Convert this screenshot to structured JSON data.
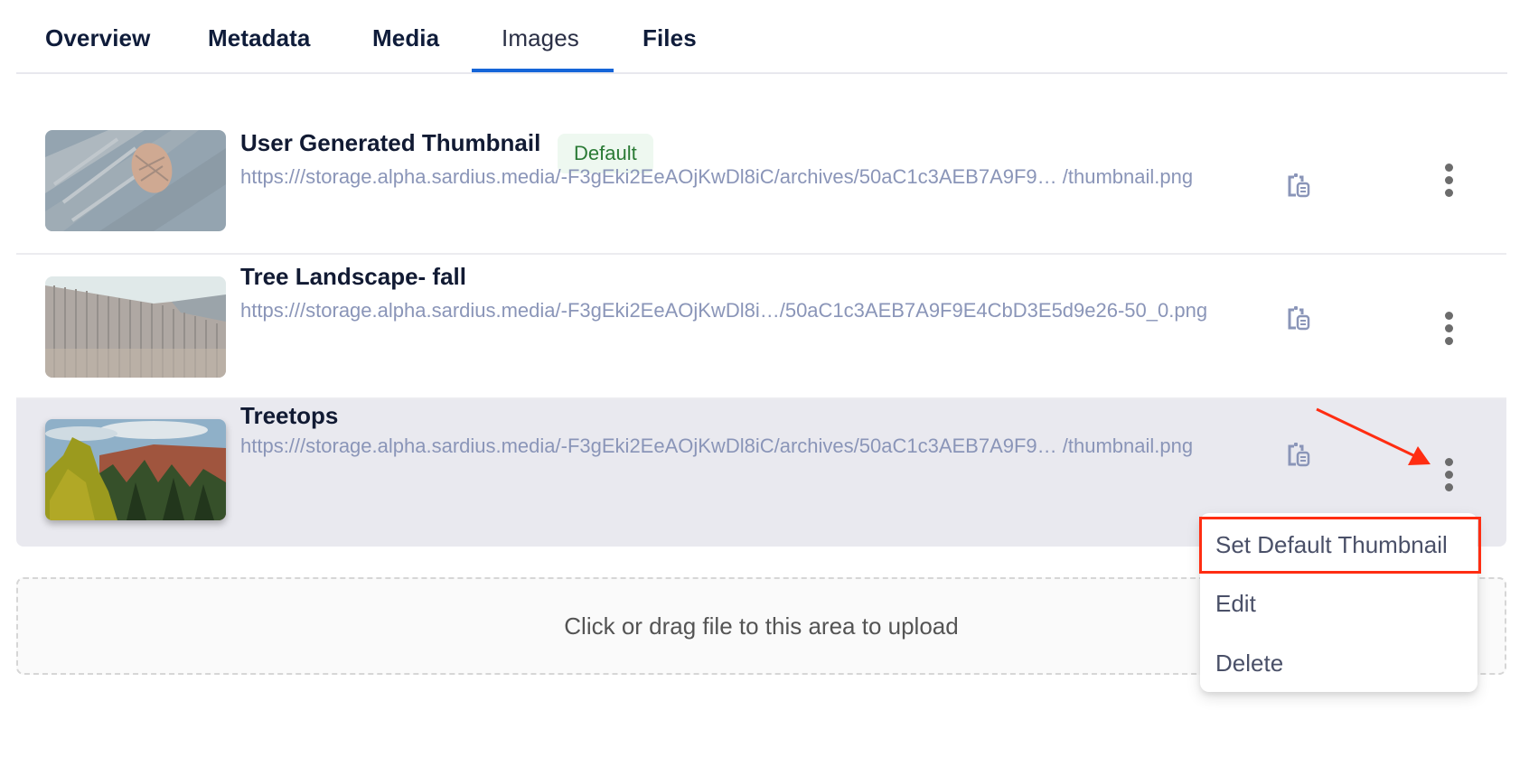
{
  "tabs": [
    {
      "label": "Overview",
      "active": false
    },
    {
      "label": "Metadata",
      "active": false
    },
    {
      "label": "Media",
      "active": false
    },
    {
      "label": "Images",
      "active": true
    },
    {
      "label": "Files",
      "active": false
    }
  ],
  "images": [
    {
      "title": "User Generated Thumbnail",
      "badge": "Default",
      "url": "https:///storage.alpha.sardius.media/-F3gEki2EeAOjKwDl8iC/archives/50aC1c3AEB7A9F9… /thumbnail.png",
      "thumbnail_subject": "pinecone on bark",
      "copy_icon": "copy-clipboard-icon",
      "menu_icon": "more-vertical-icon"
    },
    {
      "title": "Tree Landscape- fall",
      "url": "https:///storage.alpha.sardius.media/-F3gEki2EeAOjKwDl8i…/50aC1c3AEB7A9F9E4CbD3E5d9e26-50_0.png",
      "thumbnail_subject": "burnt forest hillside",
      "copy_icon": "copy-clipboard-icon",
      "menu_icon": "more-vertical-icon"
    },
    {
      "title": "Treetops",
      "url": "https:///storage.alpha.sardius.media/-F3gEki2EeAOjKwDl8iC/archives/50aC1c3AEB7A9F9… /thumbnail.png",
      "thumbnail_subject": "forest treetops",
      "copy_icon": "copy-clipboard-icon",
      "menu_icon": "more-vertical-icon"
    }
  ],
  "upload": {
    "label": "Click or drag file to this area to upload"
  },
  "context_menu": {
    "items": [
      "Set Default Thumbnail",
      "Edit",
      "Delete"
    ],
    "highlighted": "Set Default Thumbnail"
  },
  "colors": {
    "accent": "#1565d8",
    "badge_text": "#2a7a35",
    "badge_bg": "#eef8f0",
    "url_text": "#8a95b8",
    "annotation": "#ff2d12",
    "hover_row_bg": "#e9e9ef"
  }
}
